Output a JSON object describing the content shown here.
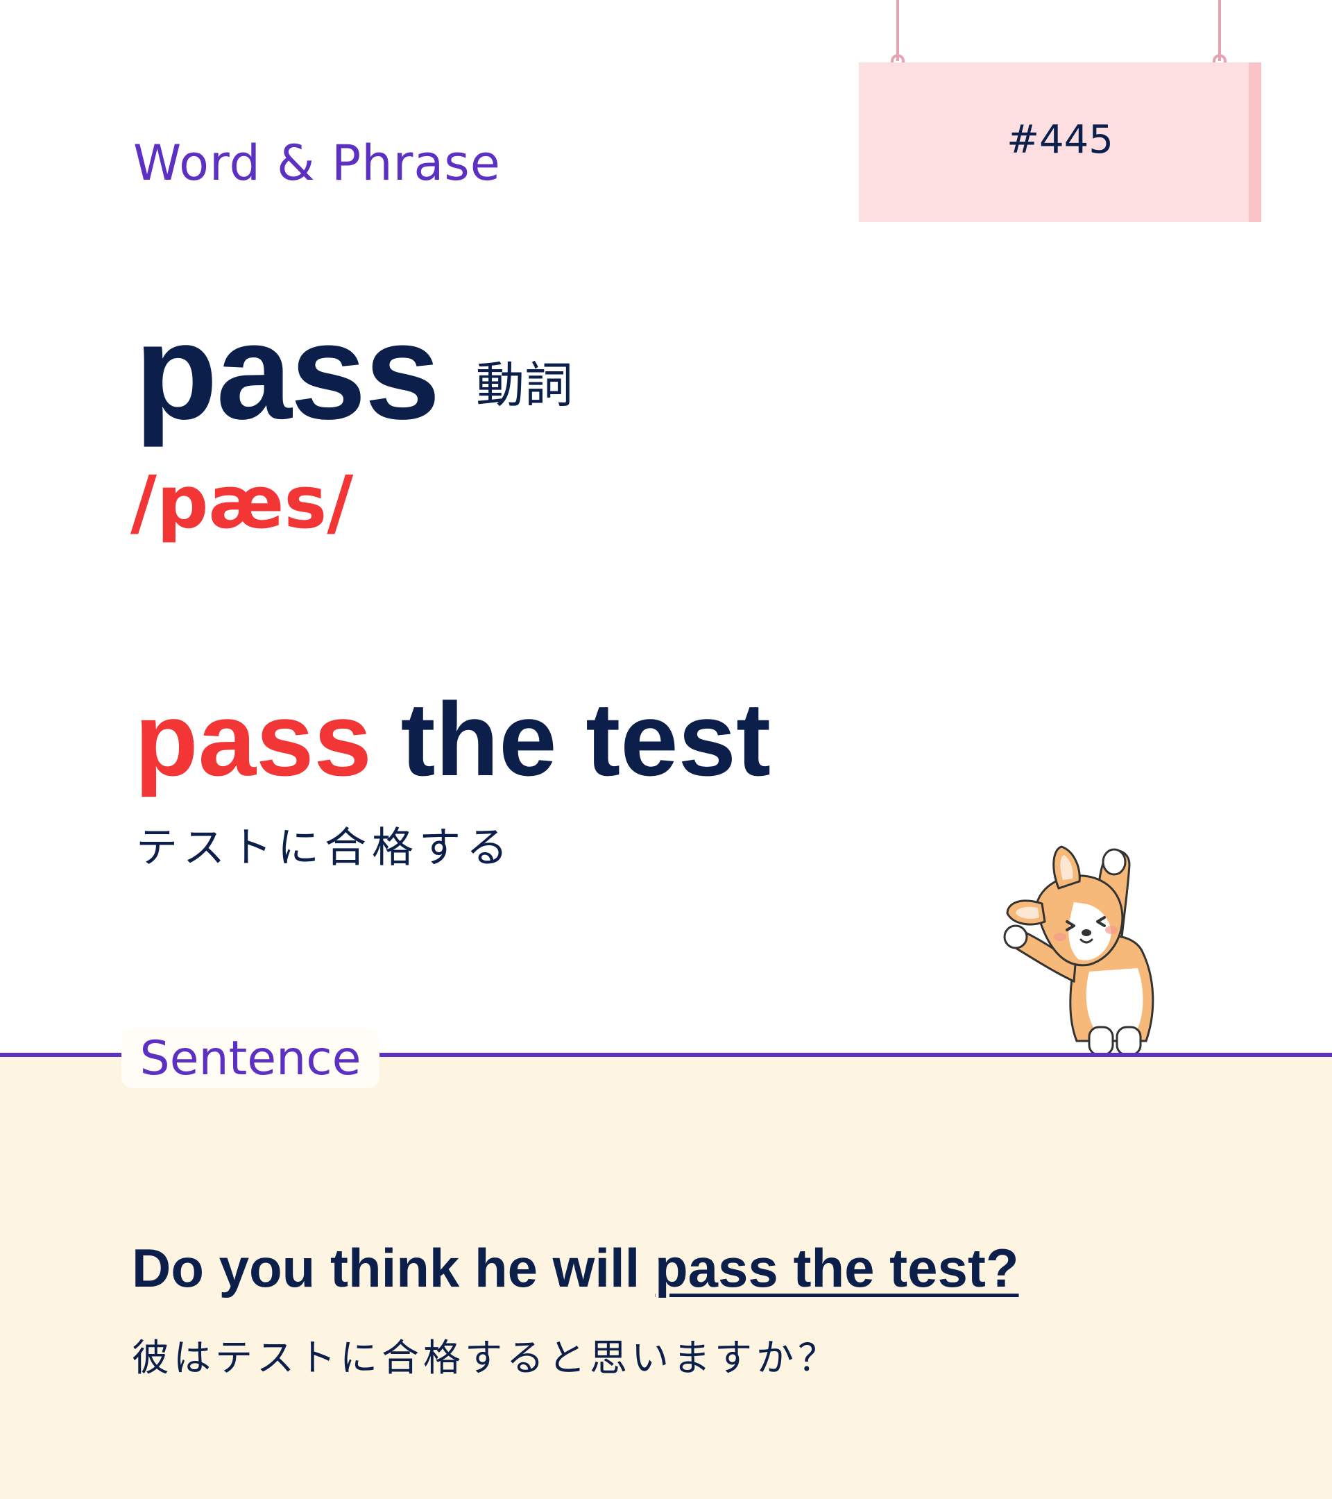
{
  "header": {
    "category": "Word & Phrase",
    "number": "#445"
  },
  "entry": {
    "word": "pass",
    "part_of_speech": "動詞",
    "pronunciation": "/pæs/"
  },
  "phrase": {
    "keyword": "pass",
    "rest": " the test",
    "translation": "テストに合格する"
  },
  "sentence_section": {
    "label": "Sentence",
    "example_prefix": "Do you think he will ",
    "example_highlight": "pass the test?",
    "translation": "彼はテストに合格すると思いますか？"
  },
  "colors": {
    "navy": "#0b1f4a",
    "accent_red": "#f23535",
    "purple": "#5b30c3",
    "sign_pink": "#fddfe2",
    "panel_cream": "#fdf5e2"
  },
  "decorations": {
    "mascot": "corgi-stretching-icon"
  }
}
